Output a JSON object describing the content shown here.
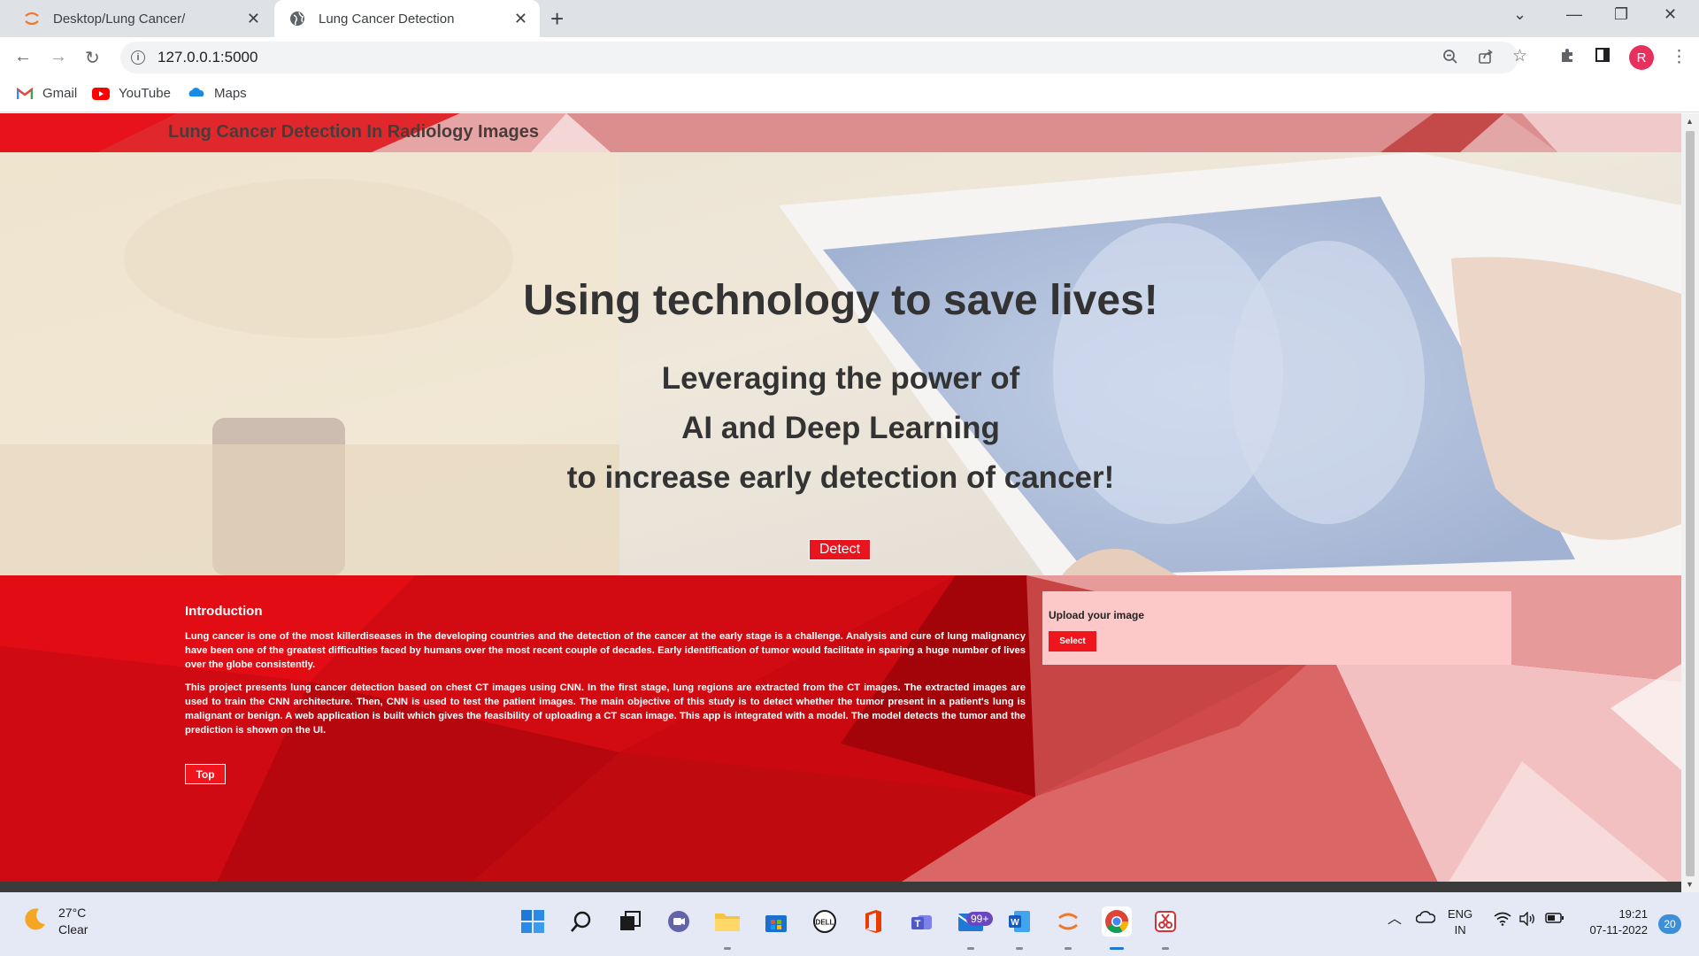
{
  "browser": {
    "tabs": [
      {
        "title": "Desktop/Lung Cancer/",
        "active": false
      },
      {
        "title": "Lung Cancer Detection",
        "active": true
      }
    ],
    "url": "127.0.0.1:5000",
    "profile_initial": "R",
    "bookmarks": [
      {
        "label": "Gmail",
        "icon": "gmail-icon"
      },
      {
        "label": "YouTube",
        "icon": "youtube-icon"
      },
      {
        "label": "Maps",
        "icon": "maps-icon"
      }
    ]
  },
  "page": {
    "brand": "Lung Cancer Detection In Radiology Images",
    "hero": {
      "headline": "Using technology to save lives!",
      "sub_line_1": "Leveraging the power of",
      "sub_line_2": "AI and Deep Learning",
      "sub_line_3": "to increase early detection of cancer!",
      "detect_label": "Detect"
    },
    "intro": {
      "heading": "Introduction",
      "paragraph_1": "Lung cancer is one of the most killerdiseases in the developing countries and the detection of the cancer at the early stage is a challenge. Analysis and cure of lung malignancy have been one of the greatest difficulties faced by humans over the most recent couple of decades. Early identification of tumor would facilitate in sparing a huge number of lives over the globe consistently.",
      "paragraph_2": "This project presents lung cancer detection based on chest CT images using CNN. In the first stage, lung regions are extracted from the CT images. The extracted images are used to train the CNN architecture. Then, CNN is used to test the patient images. The main objective of this study is to detect whether the tumor present in a patient's lung is malignant or benign. A web application is built which gives the feasibility of uploading a CT scan image. This app is integrated with a model. The model detects the tumor and the prediction is shown on the UI.",
      "top_label": "Top"
    },
    "upload": {
      "label": "Upload your image",
      "select_label": "Select"
    },
    "colors": {
      "accent_red": "#e8141e",
      "section_red": "#c40a10",
      "upload_panel": "#fdc8c8"
    }
  },
  "taskbar": {
    "weather_temp": "27°C",
    "weather_desc": "Clear",
    "mail_badge": "99+",
    "language": "ENG",
    "region": "IN",
    "time": "19:21",
    "date": "07-11-2022",
    "notification_count": "20"
  }
}
